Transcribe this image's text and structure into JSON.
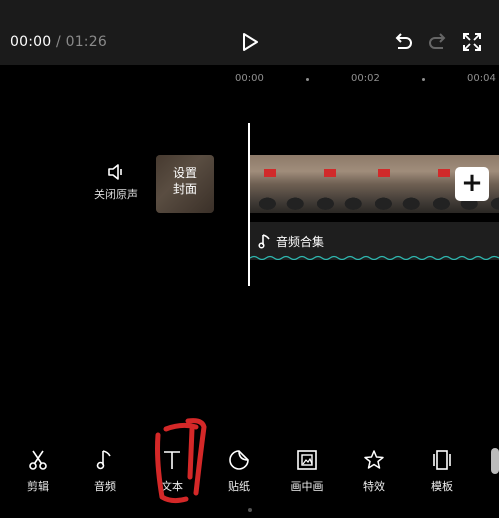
{
  "header": {
    "current_time": "00:00",
    "separator": "/",
    "total_time": "01:26",
    "icons": [
      "play-icon",
      "undo-icon",
      "redo-icon",
      "fullscreen-icon"
    ]
  },
  "ruler": {
    "labels": [
      "00:00",
      "00:02",
      "00:04"
    ]
  },
  "timeline": {
    "mute_label": "关闭原声",
    "cover_label_line1": "设置",
    "cover_label_line2": "封面",
    "audio_track_label": "音频合集",
    "add_clip_label": "+"
  },
  "toolbar": {
    "items": [
      {
        "label": "剪辑",
        "icon": "scissors-icon"
      },
      {
        "label": "音频",
        "icon": "music-note-icon"
      },
      {
        "label": "文本",
        "icon": "text-icon"
      },
      {
        "label": "贴纸",
        "icon": "sticker-icon"
      },
      {
        "label": "画中画",
        "icon": "picture-in-picture-icon"
      },
      {
        "label": "特效",
        "icon": "effects-star-icon"
      },
      {
        "label": "模板",
        "icon": "template-icon"
      }
    ]
  },
  "colors": {
    "background": "#000000",
    "topbar": "#1b1b1b",
    "audio_track": "#1e1e1e",
    "annotation": "#d42828",
    "accent_wave": "#2fb8b0"
  }
}
